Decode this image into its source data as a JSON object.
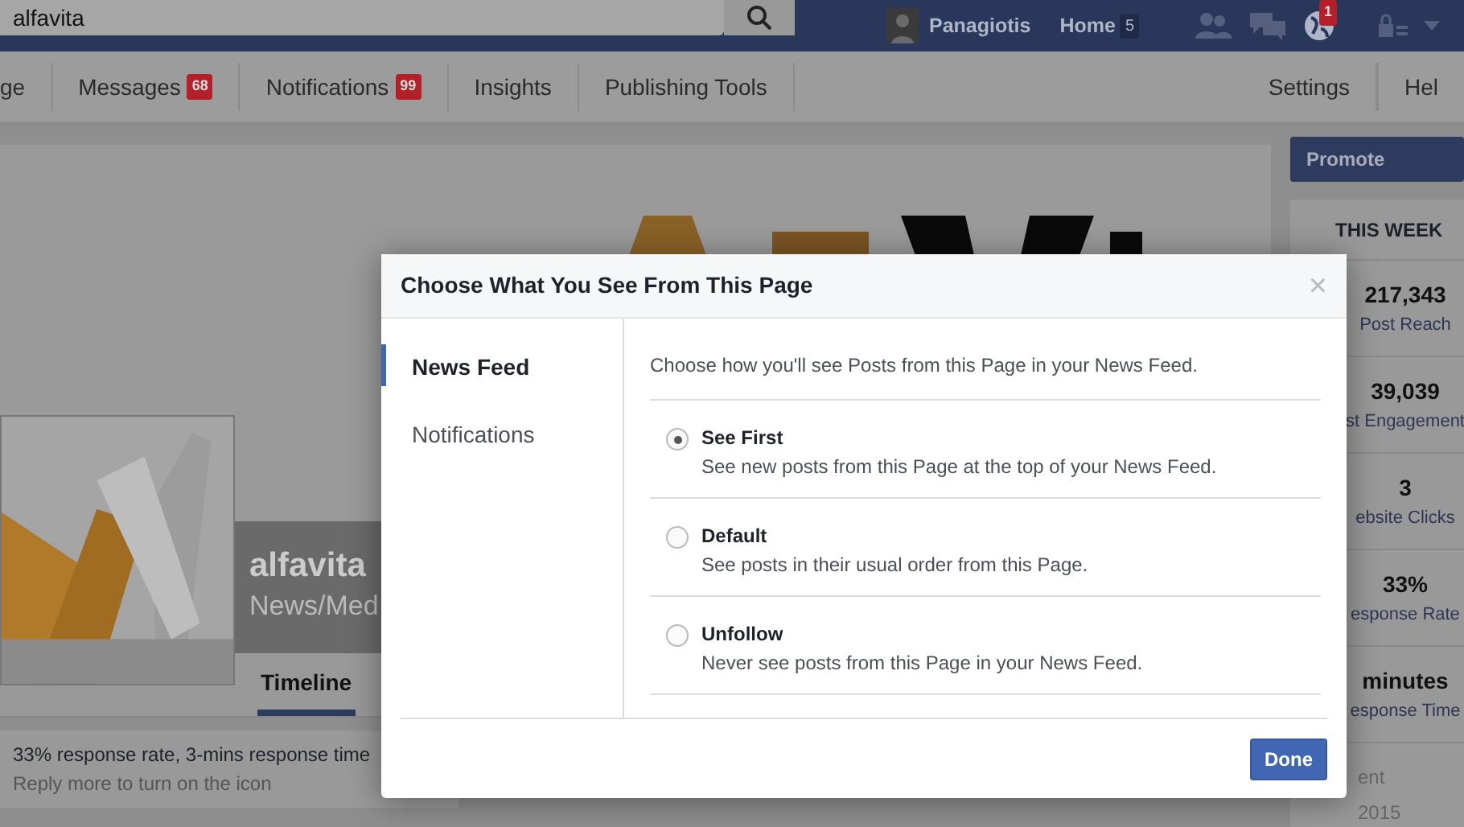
{
  "top_bar": {
    "search": {
      "value": "alfavita"
    },
    "user": "Panagiotis",
    "home": "Home",
    "home_count": "5",
    "globe_count": "1"
  },
  "page_nav": [
    {
      "label": "ge"
    },
    {
      "label": "Messages",
      "badge": "68"
    },
    {
      "label": "Notifications",
      "badge": "99"
    },
    {
      "label": "Insights"
    },
    {
      "label": "Publishing Tools"
    }
  ],
  "page_nav_right": [
    {
      "label": "Settings"
    },
    {
      "label": "Hel"
    }
  ],
  "page": {
    "name": "alfavita",
    "category": "News/Med",
    "tabs": [
      {
        "label": "Timeline",
        "selected": true
      }
    ],
    "response_info": "33% response rate, 3-mins response time",
    "response_hint": "Reply more to turn on the icon"
  },
  "sidebar": {
    "promote": "Promote",
    "week_title": "THIS WEEK",
    "stats": [
      {
        "value": "217,343",
        "label": "Post Reach"
      },
      {
        "value": "39,039",
        "label": "st Engagement"
      },
      {
        "value": "3",
        "label": "ebsite Clicks"
      },
      {
        "value": "33%",
        "label": "esponse Rate"
      },
      {
        "value": "minutes",
        "label": "esponse Time"
      }
    ],
    "footer": [
      "ent",
      "2015"
    ]
  },
  "dialog": {
    "title": "Choose What You See From This Page",
    "close": "×",
    "tabs": [
      {
        "label": "News Feed",
        "selected": true
      },
      {
        "label": "Notifications",
        "selected": false
      }
    ],
    "intro": "Choose how you'll see Posts from this Page in your News Feed.",
    "options": [
      {
        "title": "See First",
        "description": "See new posts from this Page at the top of your News Feed.",
        "selected": true
      },
      {
        "title": "Default",
        "description": "See posts in their usual order from this Page.",
        "selected": false
      },
      {
        "title": "Unfollow",
        "description": "Never see posts from this Page in your News Feed.",
        "selected": false
      }
    ],
    "done": "Done"
  }
}
